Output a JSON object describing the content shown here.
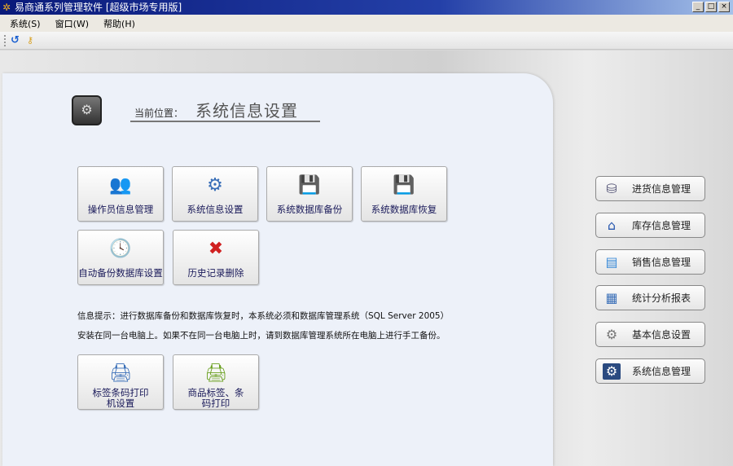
{
  "window": {
    "title": "易商通系列管理软件 [超级市场专用版]",
    "minimize": "_",
    "maximize": "□",
    "close": "×"
  },
  "menu": [
    "系统(S)",
    "窗口(W)",
    "帮助(H)"
  ],
  "location": {
    "label": "当前位置：",
    "value": "系统信息设置"
  },
  "grid_buttons": [
    {
      "label": "操作员信息管理",
      "icon": "users-icon"
    },
    {
      "label": "系统信息设置",
      "icon": "gear-icon"
    },
    {
      "label": "系统数据库备份",
      "icon": "disk-backup-icon"
    },
    {
      "label": "系统数据库恢复",
      "icon": "disk-restore-icon"
    },
    {
      "label": "自动备份数据库设置",
      "icon": "clock-disk-icon"
    },
    {
      "label": "历史记录删除",
      "icon": "delete-folder-icon"
    }
  ],
  "info": {
    "line1": "信息提示：进行数据库备份和数据库恢复时，本系统必须和数据库管理系统（SQL Server 2005）",
    "line2": "安装在同一台电脑上。如果不在同一台电脑上时，请到数据库管理系统所在电脑上进行手工备份。"
  },
  "print_buttons": [
    {
      "label": "标签条码打印机设置",
      "icon": "printer-icon"
    },
    {
      "label": "商品标签、条码打印",
      "icon": "barcode-printer-icon"
    }
  ],
  "side_buttons": [
    {
      "label": "进货信息管理",
      "icon": "database-icon"
    },
    {
      "label": "库存信息管理",
      "icon": "house-icon"
    },
    {
      "label": "销售信息管理",
      "icon": "sales-icon"
    },
    {
      "label": "统计分析报表",
      "icon": "report-icon"
    },
    {
      "label": "基本信息设置",
      "icon": "document-gear-icon"
    },
    {
      "label": "系统信息管理",
      "icon": "system-gear-icon"
    }
  ]
}
